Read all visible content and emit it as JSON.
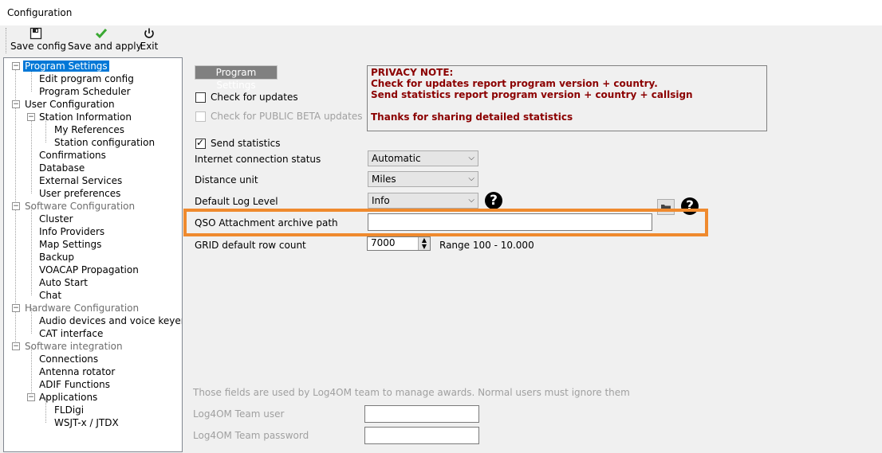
{
  "window": {
    "title": "Configuration"
  },
  "toolbar": {
    "save_config": "Save config",
    "save_apply": "Save and apply",
    "exit": "Exit"
  },
  "tree": {
    "items": [
      {
        "label": "Program Settings"
      },
      {
        "label": "Edit program config"
      },
      {
        "label": "Program Scheduler"
      },
      {
        "label": "User Configuration"
      },
      {
        "label": "Station Information"
      },
      {
        "label": "My References"
      },
      {
        "label": "Station configuration"
      },
      {
        "label": "Confirmations"
      },
      {
        "label": "Database"
      },
      {
        "label": "External Services"
      },
      {
        "label": "User preferences"
      },
      {
        "label": "Software Configuration"
      },
      {
        "label": "Cluster"
      },
      {
        "label": "Info Providers"
      },
      {
        "label": "Map Settings"
      },
      {
        "label": "Backup"
      },
      {
        "label": "VOACAP Propagation"
      },
      {
        "label": "Auto Start"
      },
      {
        "label": "Chat"
      },
      {
        "label": "Hardware Configuration"
      },
      {
        "label": "Audio devices and voice keyer"
      },
      {
        "label": "CAT interface"
      },
      {
        "label": "Software integration"
      },
      {
        "label": "Connections"
      },
      {
        "label": "Antenna rotator"
      },
      {
        "label": "ADIF Functions"
      },
      {
        "label": "Applications"
      },
      {
        "label": "FLDigi"
      },
      {
        "label": "WSJT-x / JTDX"
      }
    ]
  },
  "main": {
    "section_label": "Program Settings",
    "check_updates": "Check for updates",
    "check_beta": "Check for PUBLIC BETA updates",
    "send_stats": "Send statistics",
    "privacy": {
      "line1": "PRIVACY NOTE:",
      "line2": "Check for updates report program version + country.",
      "line3": "Send statistics report program version + country + callsign",
      "line4": "Thanks for sharing detailed statistics"
    },
    "internet_label": "Internet connection status",
    "internet_value": "Automatic",
    "distance_label": "Distance unit",
    "distance_value": "Miles",
    "loglevel_label": "Default Log Level",
    "loglevel_value": "Info",
    "qso_label": "QSO Attachment archive path",
    "qso_value": "",
    "grid_label": "GRID default row count",
    "grid_value": "7000",
    "grid_range": "Range 100 - 10.000",
    "team_note": "Those fields are used by Log4OM team to manage awards. Normal users must ignore them",
    "team_user_label": "Log4OM Team user",
    "team_password_label": "Log4OM Team password"
  },
  "colors": {
    "accent": "#0078d7",
    "highlight": "#ef8a2e",
    "privacy_text": "#8b0000"
  }
}
